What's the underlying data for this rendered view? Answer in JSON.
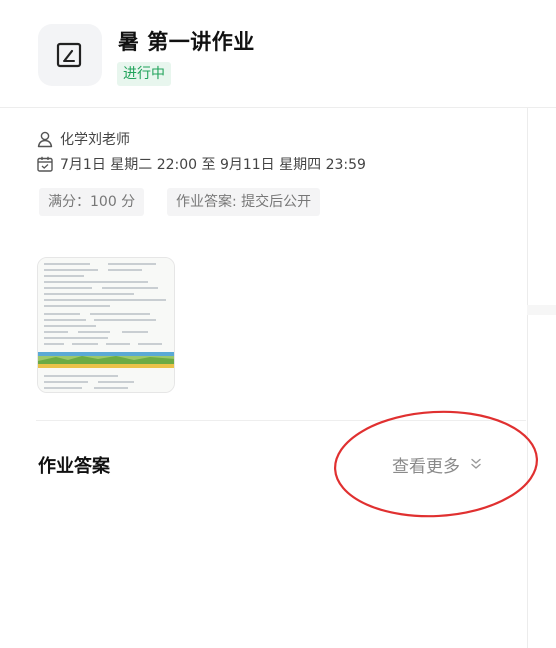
{
  "header": {
    "title": "暑 第一讲作业",
    "status": "进行中",
    "icon": "edit-icon"
  },
  "info": {
    "teacher": "化学刘老师",
    "time_range": "7月1日 星期二 22:00 至 9月11日 星期四 23:59",
    "teacher_icon": "person-icon",
    "time_icon": "calendar-icon"
  },
  "tags": {
    "score": "满分：100 分",
    "answer_policy": "作业答案: 提交后公开"
  },
  "answers": {
    "section_title": "作业答案",
    "more_label": "查看更多",
    "more_icon": "double-chevron-down-icon"
  },
  "colors": {
    "status_green": "#21a35b",
    "status_bg": "#e8f6ee",
    "annotation_red": "#e03030",
    "tag_bg": "#f4f4f5"
  }
}
